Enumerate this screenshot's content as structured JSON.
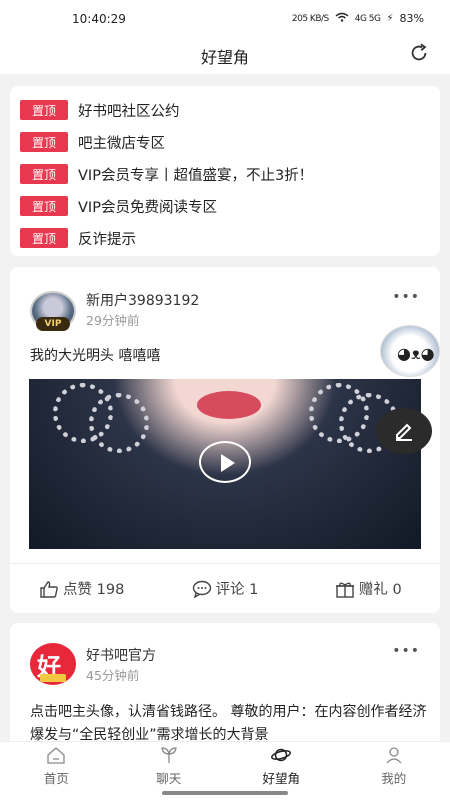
{
  "status_bar": {
    "time": "10:40:29",
    "network": "205 KB/S",
    "signal": "4G 5G",
    "battery": "83%"
  },
  "header": {
    "title": "好望角",
    "refresh_icon": "refresh-icon"
  },
  "pinned": {
    "tag_label": "置顶",
    "items": [
      "好书吧社区公约",
      "吧主微店专区",
      "VIP会员专享丨超值盛宴，不止3折！",
      "VIP会员免费阅读专区",
      "反诈提示"
    ]
  },
  "post1": {
    "username": "新用户39893192",
    "time_ago": "29分钟前",
    "vip_badge": "VIP",
    "text": "我的大光明头 嘻嘻嘻",
    "more": "•••",
    "actions": {
      "like": "点赞 198",
      "comment": "评论 1",
      "gift": "赠礼 0"
    }
  },
  "post2": {
    "username": "好书吧官方",
    "time_ago": "45分钟前",
    "avatar_char": "好",
    "more": "•••",
    "body": "点击吧主头像，认清省钱路径。 尊敬的用户：在内容创作者经济爆发与“全民轻创业”需求增长的大背景"
  },
  "tabbar": {
    "tabs": [
      {
        "label": "首页",
        "icon": "home-icon"
      },
      {
        "label": "聊天",
        "icon": "chat-icon"
      },
      {
        "label": "好望角",
        "icon": "planet-icon"
      },
      {
        "label": "我的",
        "icon": "profile-icon"
      }
    ],
    "active_index": 2
  }
}
